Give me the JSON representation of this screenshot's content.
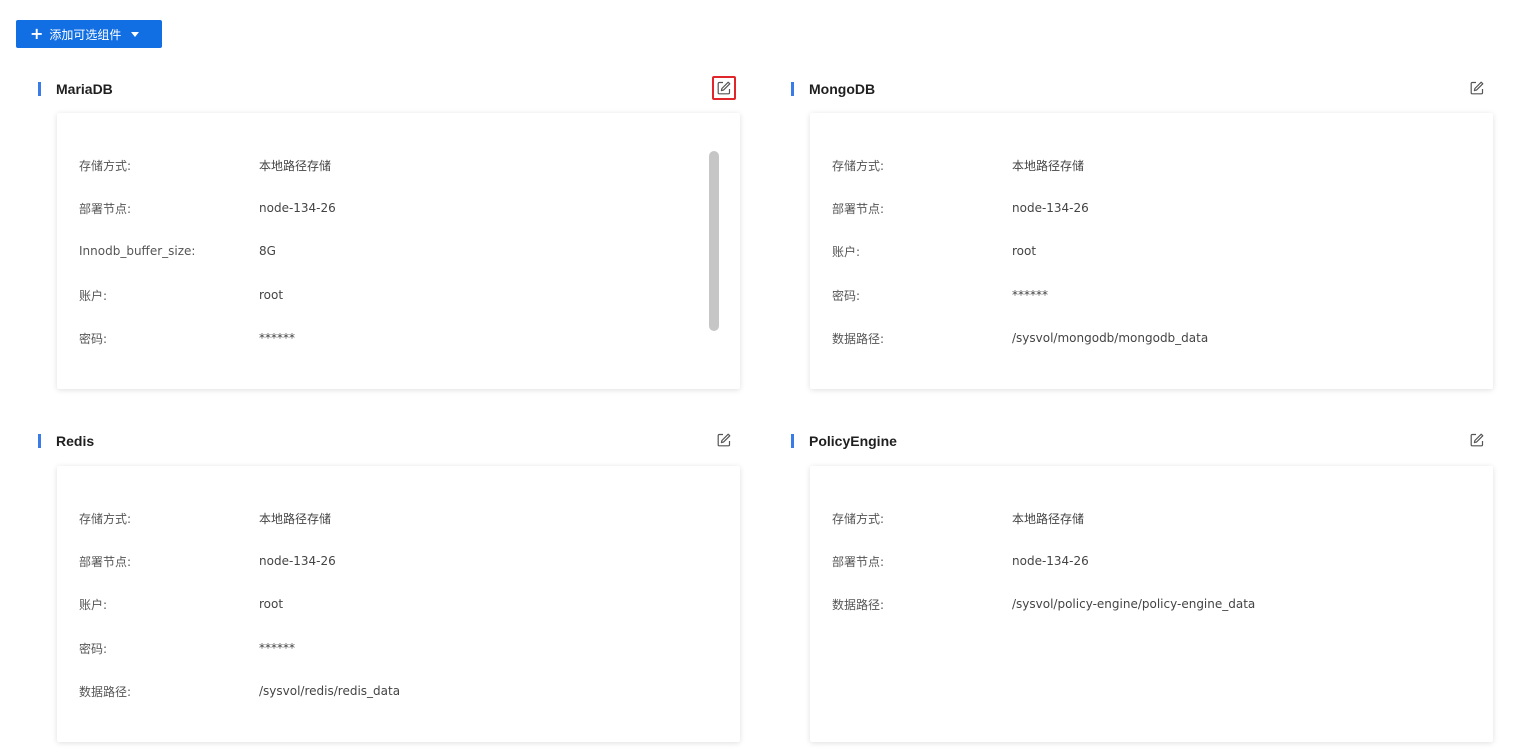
{
  "toolbar": {
    "add_button_label": "添加可选组件"
  },
  "components": [
    {
      "title": "MariaDB",
      "fields": [
        {
          "label": "存储方式:",
          "value": "本地路径存储"
        },
        {
          "label": "部署节点:",
          "value": "node-134-26"
        },
        {
          "label": "Innodb_buffer_size:",
          "value": "8G"
        },
        {
          "label": "账户:",
          "value": "root"
        },
        {
          "label": "密码:",
          "value": "******"
        }
      ]
    },
    {
      "title": "MongoDB",
      "fields": [
        {
          "label": "存储方式:",
          "value": "本地路径存储"
        },
        {
          "label": "部署节点:",
          "value": "node-134-26"
        },
        {
          "label": "账户:",
          "value": "root"
        },
        {
          "label": "密码:",
          "value": "******"
        },
        {
          "label": "数据路径:",
          "value": "/sysvol/mongodb/mongodb_data"
        }
      ]
    },
    {
      "title": "Redis",
      "fields": [
        {
          "label": "存储方式:",
          "value": "本地路径存储"
        },
        {
          "label": "部署节点:",
          "value": "node-134-26"
        },
        {
          "label": "账户:",
          "value": "root"
        },
        {
          "label": "密码:",
          "value": "******"
        },
        {
          "label": "数据路径:",
          "value": "/sysvol/redis/redis_data"
        }
      ]
    },
    {
      "title": "PolicyEngine",
      "fields": [
        {
          "label": "存储方式:",
          "value": "本地路径存储"
        },
        {
          "label": "部署节点:",
          "value": "node-134-26"
        },
        {
          "label": "数据路径:",
          "value": "/sysvol/policy-engine/policy-engine_data"
        }
      ]
    }
  ],
  "icons": {
    "edit": "edit-icon",
    "add": "plus-icon",
    "dropdown": "caret-down-icon"
  },
  "colors": {
    "primary": "#126ee3",
    "section_bar": "#3a7bea",
    "highlight": "#e0262b"
  }
}
